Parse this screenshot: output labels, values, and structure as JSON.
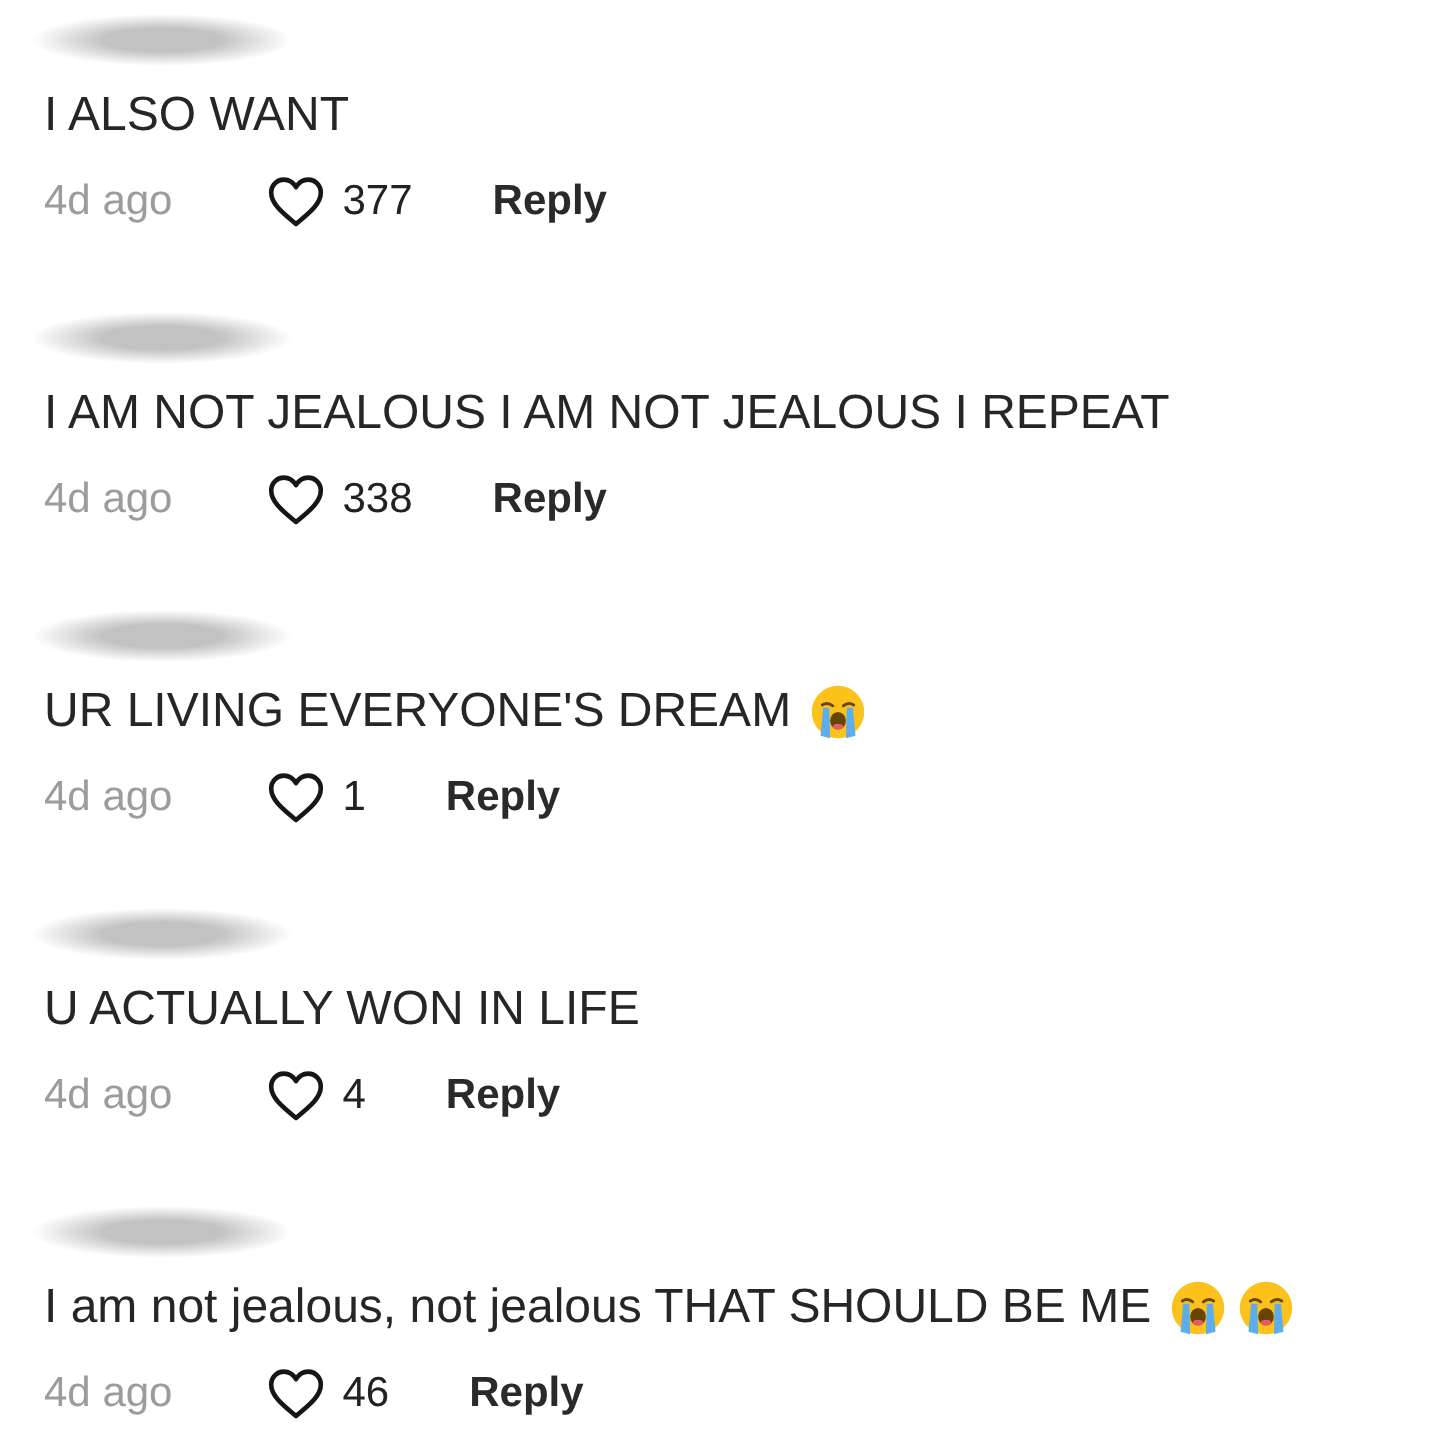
{
  "comments": [
    {
      "username_blurred": true,
      "text": "I ALSO WANT",
      "time": "4d ago",
      "liked": false,
      "likes": "377",
      "reply": "Reply"
    },
    {
      "username_blurred": true,
      "text": "I AM NOT JEALOUS I AM NOT JEALOUS I REPEAT",
      "time": "4d ago",
      "liked": false,
      "likes": "338",
      "reply": "Reply"
    },
    {
      "username_blurred": true,
      "text": "UR LIVING EVERYONE'S DREAM",
      "emojis": [
        {
          "kind": "loudly-crying"
        }
      ],
      "time": "4d ago",
      "liked": false,
      "likes": "1",
      "reply": "Reply"
    },
    {
      "username_blurred": true,
      "text": "U ACTUALLY WON IN LIFE",
      "time": "4d ago",
      "liked": false,
      "likes": "4",
      "reply": "Reply"
    },
    {
      "username_blurred": true,
      "text": "I am not jealous, not jealous THAT SHOULD BE ME",
      "emojis": [
        {
          "kind": "loudly-crying"
        },
        {
          "kind": "loudly-crying"
        }
      ],
      "time": "4d ago",
      "liked": false,
      "likes": "46",
      "reply": "Reply"
    }
  ]
}
